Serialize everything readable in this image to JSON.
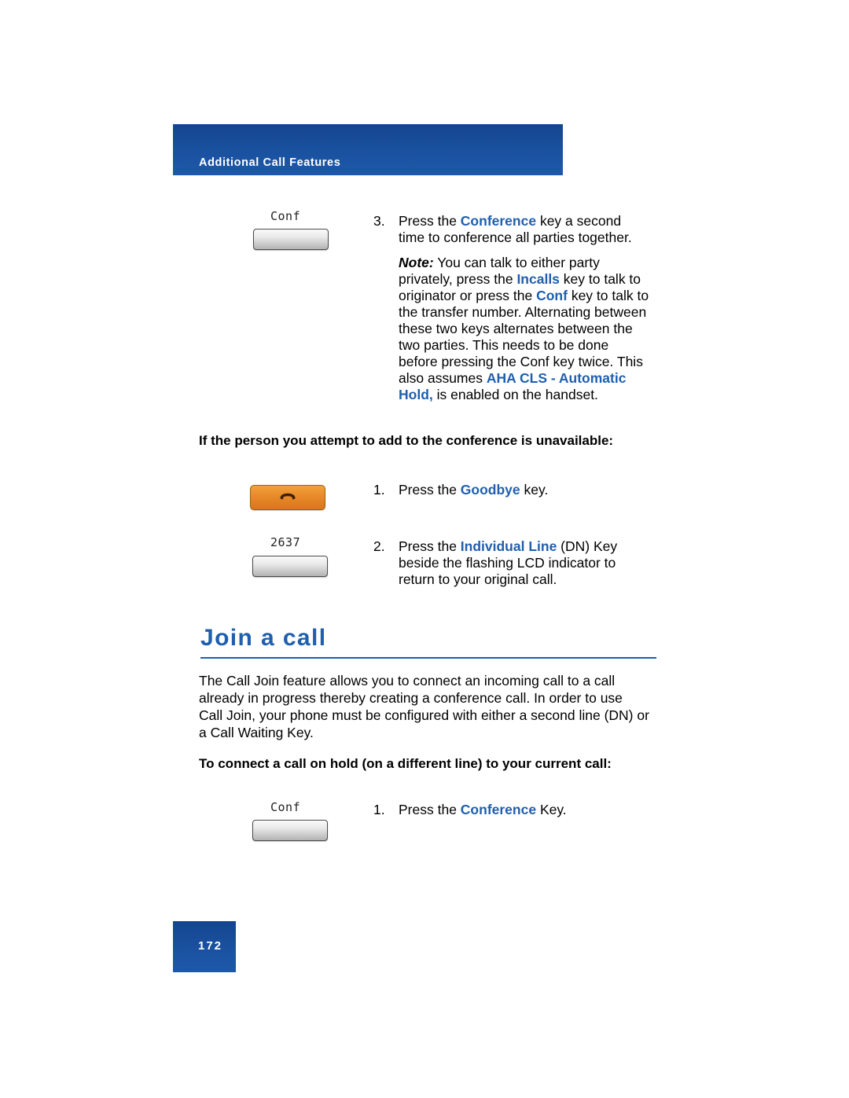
{
  "header": {
    "title": "Additional Call Features"
  },
  "footer": {
    "page_number": "172"
  },
  "colors": {
    "brand_blue": "#1a4f9c",
    "accent_blue": "#1f5fae",
    "goodbye_orange": "#e8892a"
  },
  "steps_conference": {
    "step3_num": "3.",
    "step3_line1_a": "Press the ",
    "step3_line1_b": "Conference",
    "step3_line1_c": " key a second",
    "step3_line2": "time to conference all parties together.",
    "note_label": "Note:",
    "note_l1": " You can talk to either party",
    "note_l2_a": "privately, press the ",
    "note_l2_b": "Incalls",
    "note_l2_c": " key to talk to",
    "note_l3_a": "originator or press the ",
    "note_l3_b": "Conf",
    "note_l3_c": " key to talk to",
    "note_l4": "the transfer number. Alternating between",
    "note_l5": "these two keys alternates between the",
    "note_l6": "two parties. This needs to be done",
    "note_l7": "before pressing the Conf key twice. This",
    "note_l8_a": "also assumes ",
    "note_l8_b": "AHA CLS - Automatic",
    "note_l9_b": "Hold,",
    "note_l9_c": " is enabled on the handset.",
    "key_conf_label": "Conf"
  },
  "unavailable_section": {
    "heading": "If the person you attempt to add to the conference is unavailable:",
    "step1_num": "1.",
    "step1_a": "Press the ",
    "step1_b": "Goodbye",
    "step1_c": " key.",
    "step2_num": "2.",
    "step2_l1_a": "Press the ",
    "step2_l1_b": "Individual Line",
    "step2_l1_c": " (DN) Key",
    "step2_l2": "beside the flashing LCD indicator to",
    "step2_l3": "return to your original call.",
    "key_dn_label": "2637",
    "goodbye_icon": "handset-icon"
  },
  "join_section": {
    "heading": "Join a call",
    "body_l1": "The Call Join feature allows you to connect an incoming call to a call",
    "body_l2": "already in progress thereby creating a conference call. In order to use",
    "body_l3": "Call Join, your phone must be configured with either a second line (DN) or",
    "body_l4": "a Call Waiting Key.",
    "subheading": "To connect a call on hold (on a different line) to your current call:",
    "step1_num": "1.",
    "step1_a": "Press the ",
    "step1_b": "Conference",
    "step1_c": " Key.",
    "key_conf_label": "Conf"
  }
}
